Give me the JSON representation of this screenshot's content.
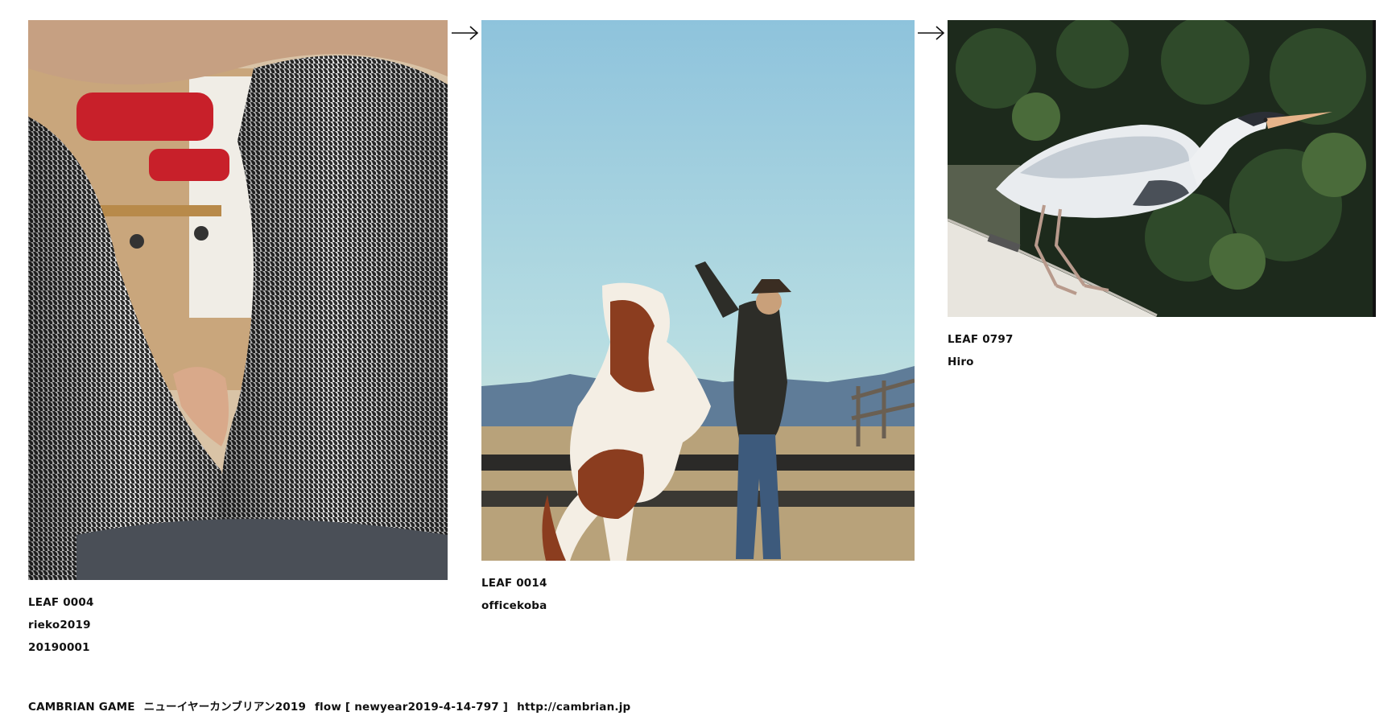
{
  "leaves": [
    {
      "id": "LEAF 0004",
      "author": "rieko2019",
      "code": "20190001"
    },
    {
      "id": "LEAF 0014",
      "author": "officekoba"
    },
    {
      "id": "LEAF 0797",
      "author": "Hiro"
    }
  ],
  "footer": {
    "game": "CAMBRIAN GAME",
    "title": "ニューイヤーカンブリアン2019",
    "flow": "flow [ newyear2019-4-14-797 ]",
    "url": "http://cambrian.jp"
  }
}
